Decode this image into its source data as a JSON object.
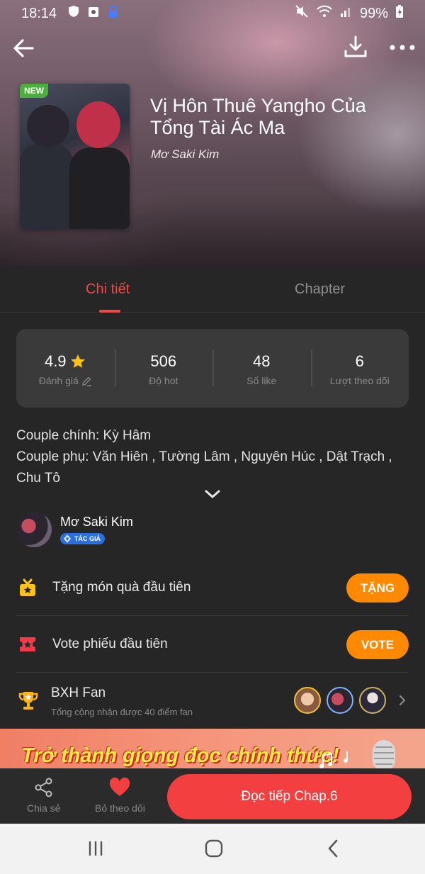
{
  "status_bar": {
    "time": "18:14",
    "battery": "99%"
  },
  "book": {
    "badge": "NEW",
    "title": "Vị Hôn Thuê Yangho Của Tổng Tài Ác Ma",
    "author": "Mơ Saki Kim"
  },
  "tabs": [
    {
      "label": "Chi tiết",
      "active": true
    },
    {
      "label": "Chapter",
      "active": false
    }
  ],
  "stats": [
    {
      "value": "4.9",
      "label": "Đánh giá"
    },
    {
      "value": "506",
      "label": "Độ hot"
    },
    {
      "value": "48",
      "label": "Số like"
    },
    {
      "value": "6",
      "label": "Lượt theo dõi"
    }
  ],
  "description": {
    "line1": "Couple chính: Kỳ Hâm",
    "line2": "Couple phụ: Văn Hiên , Tường Lâm , Nguyên Húc , Dật Trạch , Chu Tô"
  },
  "author": {
    "name": "Mơ Saki Kim",
    "badge": "TÁC GIẢ"
  },
  "actions": {
    "gift": {
      "label": "Tặng món quà đầu tiên",
      "button": "TẶNG"
    },
    "vote": {
      "label": "Vote phiếu đầu tiên",
      "button": "VOTE"
    },
    "fan": {
      "title": "BXH Fan",
      "subtitle": "Tổng cộng nhận được 40 điểm fan"
    }
  },
  "promo": {
    "text": "Trở thành giọng đọc chính thức!"
  },
  "bottom_bar": {
    "share": "Chia sẻ",
    "unfollow": "Bỏ theo dõi",
    "read": "Đọc tiếp Chap.6"
  },
  "colors": {
    "accent": "#f04a48",
    "orange": "#ff8a00",
    "read_button": "#f43f40",
    "background": "#262626"
  }
}
